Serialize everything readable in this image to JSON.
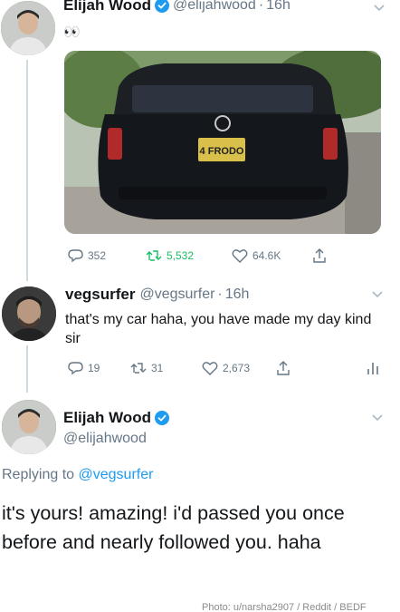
{
  "tweet": {
    "author_name": "Elijah Wood",
    "author_handle": "@elijahwood",
    "time": "16h",
    "text": "👀",
    "plate_text": "4 FRODO",
    "stats": {
      "replies": "352",
      "retweets": "5,532",
      "likes": "64.6K"
    }
  },
  "reply": {
    "author_name": "vegsurfer",
    "author_handle": "@vegsurfer",
    "time": "16h",
    "text": "that's my car haha, you have made my day kind sir",
    "stats": {
      "replies": "19",
      "retweets": "31",
      "likes": "2,673"
    }
  },
  "main_reply": {
    "author_name": "Elijah Wood",
    "author_handle": "@elijahwood",
    "replying_prefix": "Replying to",
    "replying_to": "@vegsurfer",
    "text": "it's yours! amazing! i'd passed you once before and nearly followed you. haha"
  },
  "credit": "Photo: u/narsha2907 / Reddit / BEDF",
  "colors": {
    "verified": "#1d9bf0",
    "link": "#1d9bf0",
    "muted": "#657786"
  },
  "icons": [
    "verified-badge-icon",
    "reply-icon",
    "retweet-icon",
    "like-icon",
    "share-icon",
    "analytics-icon",
    "chevron-down-icon"
  ]
}
